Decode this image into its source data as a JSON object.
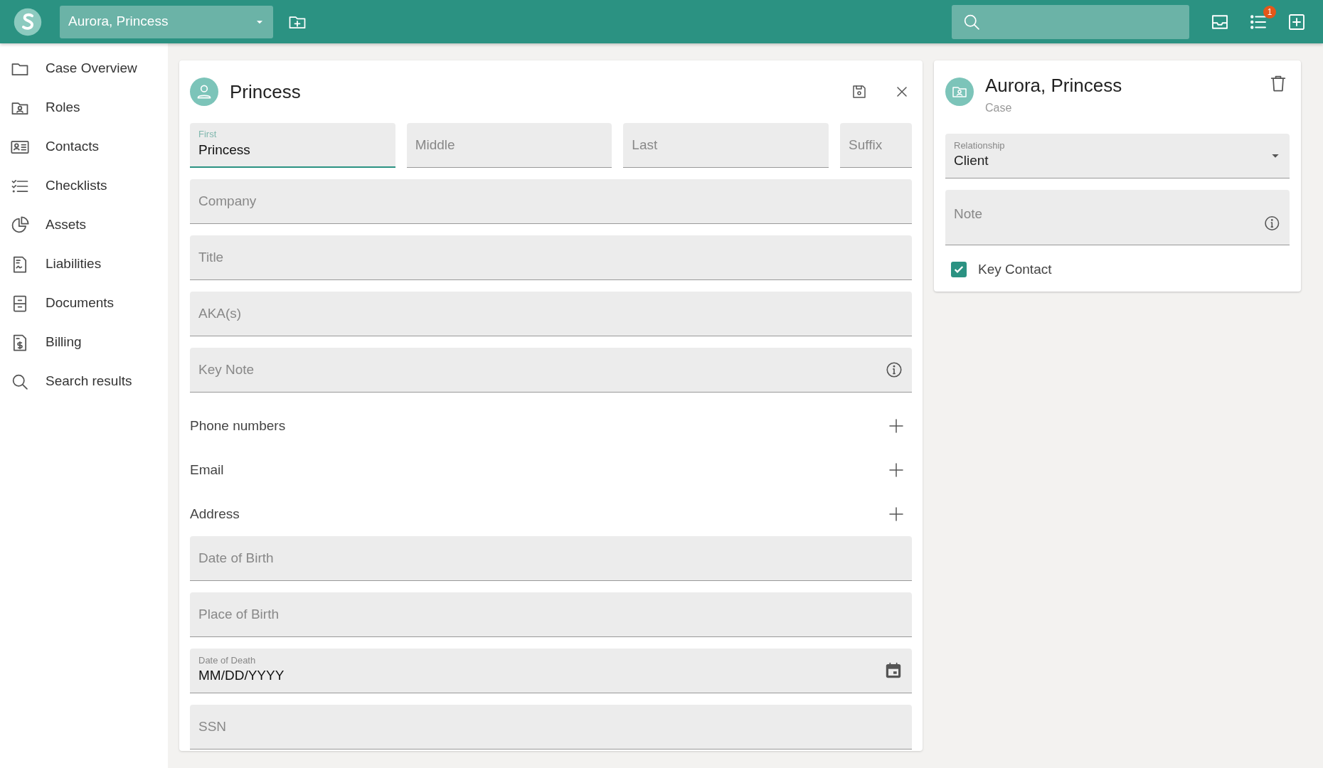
{
  "topbar": {
    "case_selector": {
      "value": "Aurora, Princess"
    },
    "notification_count": "1"
  },
  "sidebar": {
    "items": [
      {
        "label": "Case Overview"
      },
      {
        "label": "Roles"
      },
      {
        "label": "Contacts"
      },
      {
        "label": "Checklists"
      },
      {
        "label": "Assets"
      },
      {
        "label": "Liabilities"
      },
      {
        "label": "Documents"
      },
      {
        "label": "Billing"
      },
      {
        "label": "Search results"
      }
    ]
  },
  "contact_form": {
    "title": "Princess",
    "name_fields": [
      {
        "label": "First",
        "value": "Princess",
        "focused": true
      },
      {
        "placeholder": "Middle",
        "focused": false
      },
      {
        "placeholder": "Last",
        "focused": false
      },
      {
        "placeholder": "Suffix",
        "focused": false
      }
    ],
    "fields_top": [
      {
        "kind": "text",
        "placeholder": "Company"
      },
      {
        "kind": "text",
        "placeholder": "Title"
      },
      {
        "kind": "text",
        "placeholder": "AKA(s)"
      },
      {
        "kind": "info",
        "placeholder": "Key Note"
      }
    ],
    "sections": [
      {
        "label": "Phone numbers"
      },
      {
        "label": "Email"
      },
      {
        "label": "Address"
      }
    ],
    "fields_bottom": [
      {
        "kind": "text",
        "placeholder": "Date of Birth"
      },
      {
        "kind": "text",
        "placeholder": "Place of Birth"
      },
      {
        "kind": "date",
        "label": "Date of Death",
        "placeholder": "MM/DD/YYYY"
      },
      {
        "kind": "text",
        "placeholder": "SSN"
      }
    ]
  },
  "case_card": {
    "title": "Aurora, Princess",
    "subtitle": "Case",
    "relationship": {
      "label": "Relationship",
      "value": "Client"
    },
    "note": {
      "placeholder": "Note"
    },
    "key_contact": {
      "label": "Key Contact",
      "checked": true
    }
  }
}
